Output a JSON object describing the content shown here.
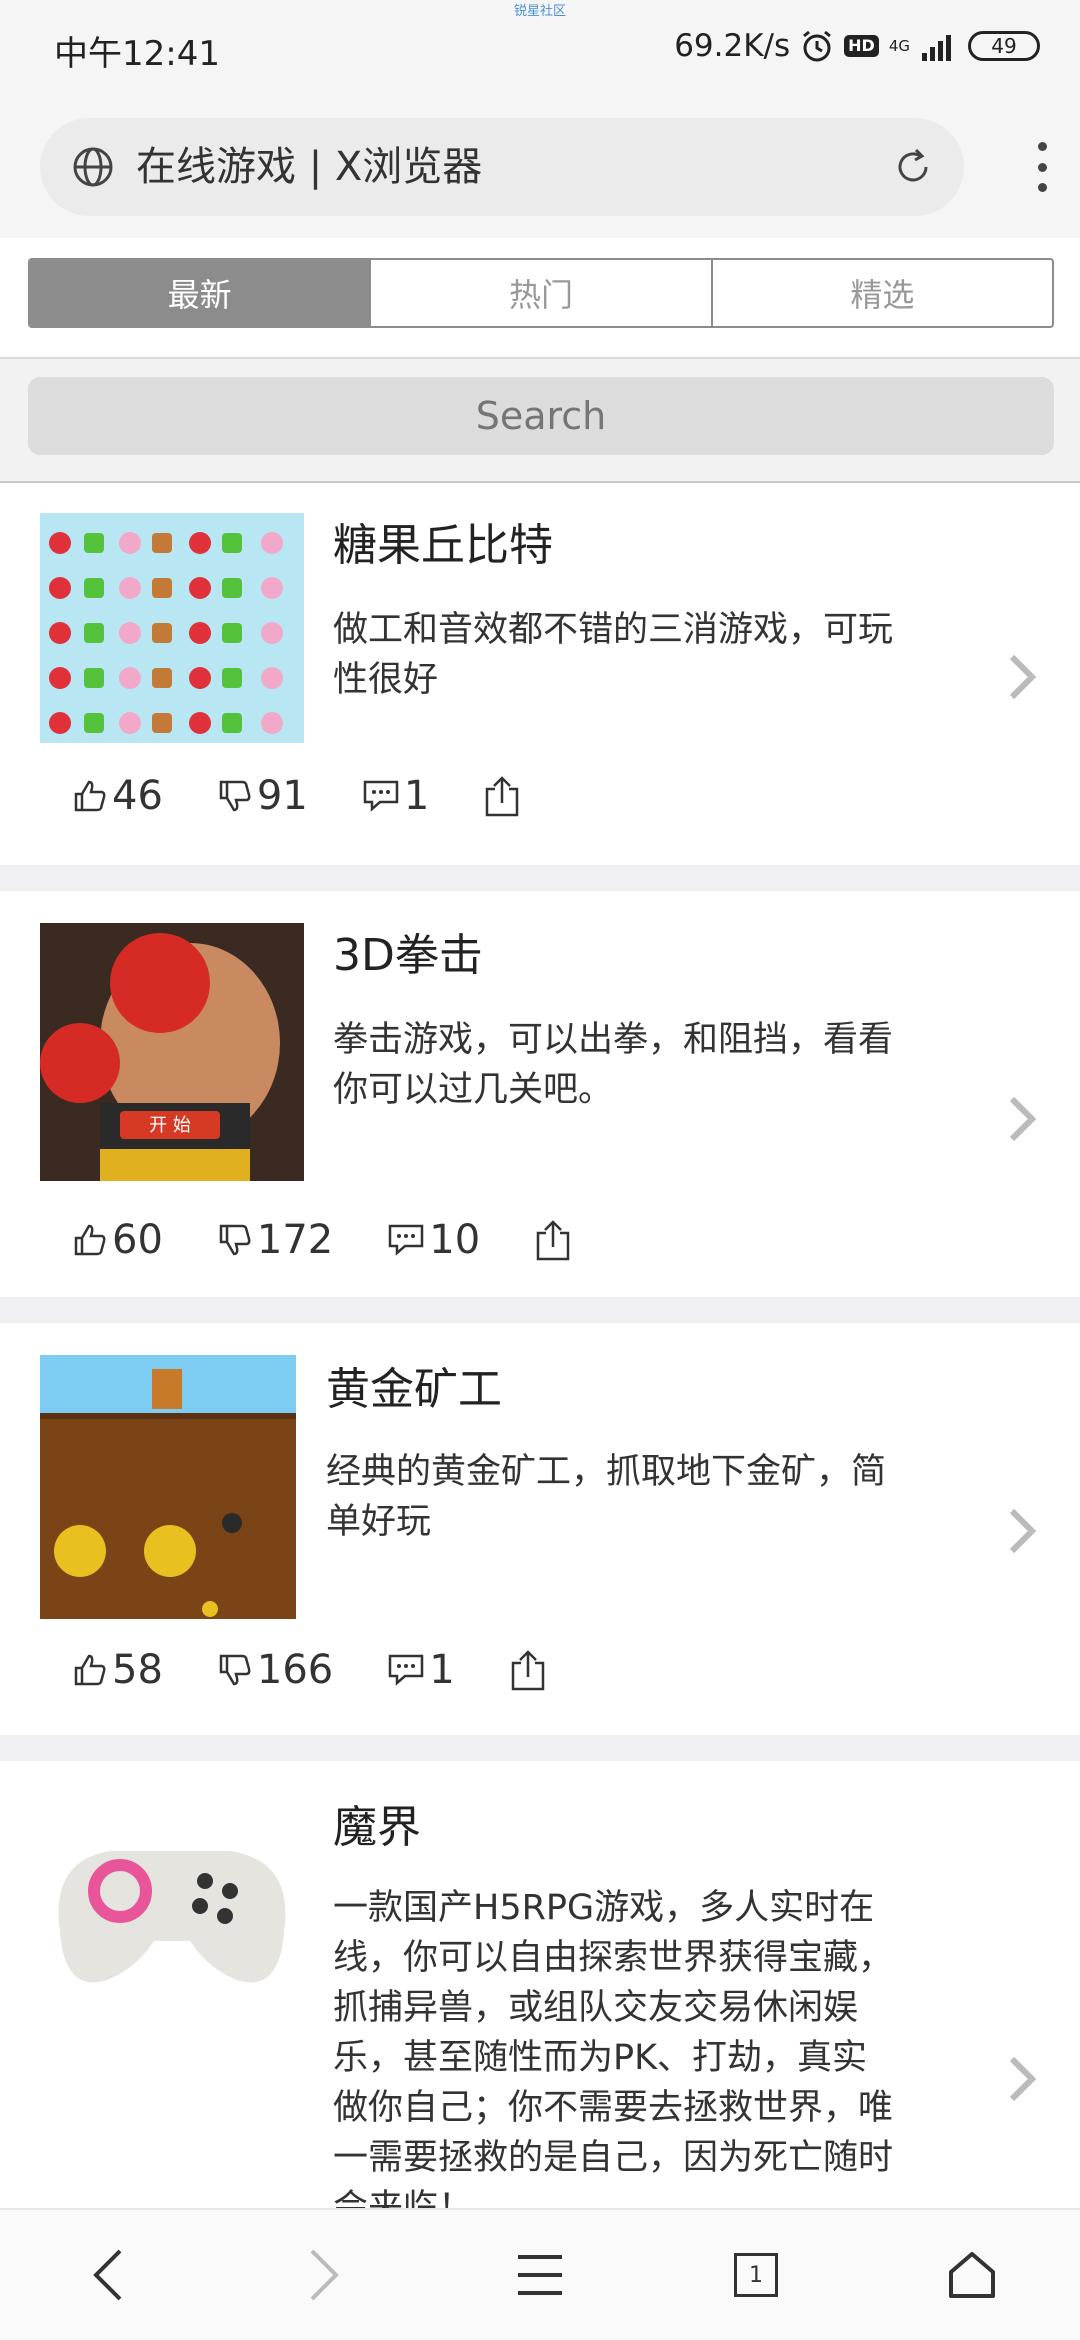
{
  "status_bar": {
    "time": "中午12:41",
    "net_speed": "69.2K/s",
    "hd": "HD",
    "net_type": "4G",
    "battery": "49",
    "watermark": "锐星社区"
  },
  "browser": {
    "title": "在线游戏 | X浏览器"
  },
  "tabs": [
    {
      "label": "最新",
      "active": true
    },
    {
      "label": "热门",
      "active": false
    },
    {
      "label": "精选",
      "active": false
    }
  ],
  "search": {
    "placeholder": "Search"
  },
  "games": [
    {
      "name": "糖果丘比特",
      "desc": "做工和音效都不错的三消游戏，可玩性很好",
      "likes": "46",
      "dislikes": "91",
      "comments": "1",
      "thumb_icon": "candy-match-thumbnail"
    },
    {
      "name": "3D拳击",
      "desc": "拳击游戏，可以出拳，和阻挡，看看你可以过几关吧。",
      "likes": "60",
      "dislikes": "172",
      "comments": "10",
      "thumb_icon": "boxing-thumbnail",
      "thumb_label": "开 始"
    },
    {
      "name": "黄金矿工",
      "desc": "经典的黄金矿工，抓取地下金矿，简单好玩",
      "likes": "58",
      "dislikes": "166",
      "comments": "1",
      "thumb_icon": "gold-miner-thumbnail"
    },
    {
      "name": "魔界",
      "desc": "一款国产H5RPG游戏，多人实时在线，你可以自由探索世界获得宝藏，抓捕异兽，或组队交友交易休闲娱乐，甚至随性而为PK、打劫，真实做你自己；你不需要去拯救世界，唯一需要拯救的是自己，因为死亡随时会来临！",
      "thumb_icon": "gamepad-thumbnail"
    }
  ],
  "bottom_nav": {
    "tab_count": "1",
    "icons": [
      "back-icon",
      "forward-icon",
      "menu-icon",
      "tabs-icon",
      "home-icon"
    ]
  },
  "colors": {
    "tab_active_bg": "#8c8c8c",
    "separator": "#efeff4",
    "chevron": "#bbbbbb"
  }
}
